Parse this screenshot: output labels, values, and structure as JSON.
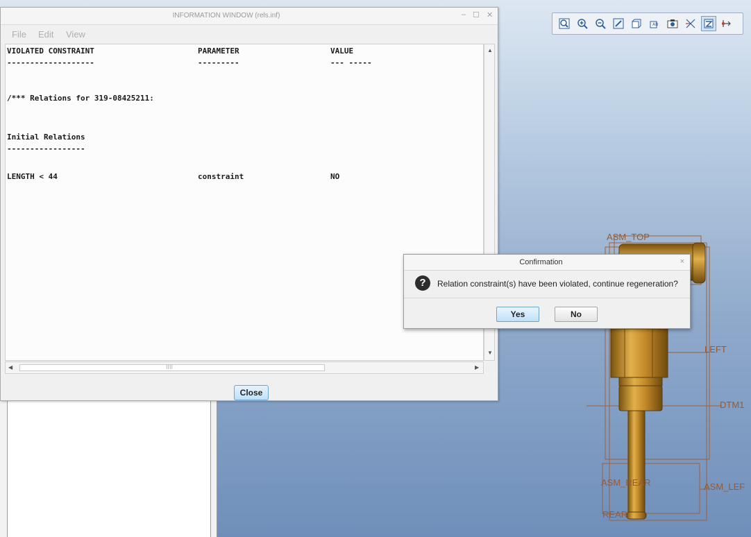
{
  "info_window": {
    "title": "INFORMATION WINDOW (rels.inf)",
    "menu": [
      "File",
      "Edit",
      "View"
    ],
    "lines": [
      {
        "c1": "VIOLATED CONSTRAINT",
        "c2": "PARAMETER",
        "c3": "VALUE"
      },
      {
        "c1": "-------------------",
        "c2": "---------",
        "c3": "--- -----"
      },
      {
        "c1": "/*** Relations for 319-08425211:",
        "c2": "",
        "c3": ""
      },
      {
        "c1": "Initial Relations",
        "c2": "",
        "c3": ""
      },
      {
        "c1": "-----------------",
        "c2": "",
        "c3": ""
      },
      {
        "c1": "LENGTH < 44",
        "c2": "constraint",
        "c3": "NO"
      }
    ],
    "close_label": "Close",
    "hscroll_grip": "IIII"
  },
  "confirmation": {
    "title": "Confirmation",
    "close_glyph": "×",
    "icon_glyph": "?",
    "message": "Relation constraint(s) have been violated, continue regeneration?",
    "yes_label": "Yes",
    "no_label": "No"
  },
  "model_labels": {
    "asm_top": "ASM_TOP",
    "left": "LEFT",
    "dtm": "DTM1",
    "asm_rear": "ASM_REAR",
    "asm_left": "ASM_LEF",
    "rear": "REAR"
  },
  "toolbar": {
    "icons": [
      "refit-icon",
      "zoom-in-icon",
      "zoom-out-icon",
      "repaint-icon",
      "saved-orientations-icon",
      "display-style-icon",
      "view-manager-icon",
      "datum-display-icon",
      "spin-center-icon",
      "annotation-display-icon"
    ]
  },
  "colors": {
    "accent_button": "#bfe0f8",
    "model_brass": "#c48a2a",
    "label_color": "#9a5a30"
  }
}
